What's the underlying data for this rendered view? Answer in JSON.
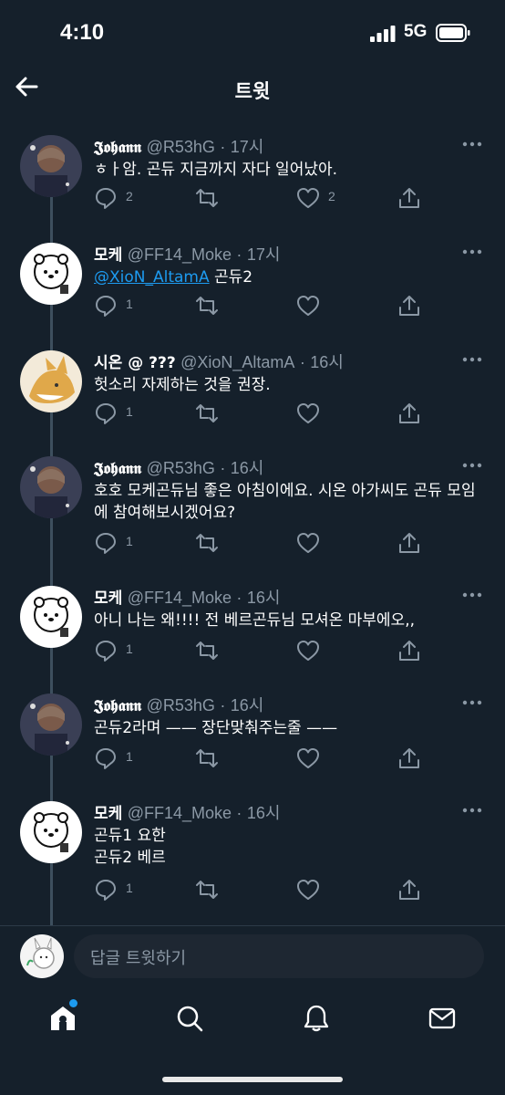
{
  "status": {
    "time": "4:10",
    "network": "5G"
  },
  "header": {
    "title": "트윗"
  },
  "tweets": [
    {
      "name": "𝕵𝖔𝖍𝖆𝖓𝖓",
      "handle": "@R53hG",
      "dot": "·",
      "time": "17시",
      "text": "ㅎㅏ암. 곤듀 지금까지 자다 일어났아.",
      "mention": "",
      "replies": "2",
      "retweets": "",
      "likes": "2"
    },
    {
      "name": "모케",
      "handle": "@FF14_Moke",
      "dot": "·",
      "time": "17시",
      "text": " 곤듀2",
      "mention": "@XioN_AltamA",
      "replies": "1",
      "retweets": "",
      "likes": ""
    },
    {
      "name": "시온 @ ???",
      "handle": "@XioN_AltamA",
      "dot": "·",
      "time": "16시",
      "text": "헛소리 자제하는 것을 권장.",
      "mention": "",
      "replies": "1",
      "retweets": "",
      "likes": ""
    },
    {
      "name": "𝕵𝖔𝖍𝖆𝖓𝖓",
      "handle": "@R53hG",
      "dot": "·",
      "time": "16시",
      "text": "호호 모케곤듀님 좋은 아침이에요. 시온 아가씨도 곤듀 모임에 참여해보시겠어요?",
      "mention": "",
      "replies": "1",
      "retweets": "",
      "likes": ""
    },
    {
      "name": "모케",
      "handle": "@FF14_Moke",
      "dot": "·",
      "time": "16시",
      "text": "아니 나는 왜!!!! 전 베르곤듀님 모셔온 마부에오,,",
      "mention": "",
      "replies": "1",
      "retweets": "",
      "likes": ""
    },
    {
      "name": "𝕵𝖔𝖍𝖆𝖓𝖓",
      "handle": "@R53hG",
      "dot": "·",
      "time": "16시",
      "text": "곤듀2라며 —— 장단맞춰주는줄 ——",
      "mention": "",
      "replies": "1",
      "retweets": "",
      "likes": ""
    },
    {
      "name": "모케",
      "handle": "@FF14_Moke",
      "dot": "·",
      "time": "16시",
      "text": "곤듀1 요한\n곤듀2 베르",
      "mention": "",
      "replies": "1",
      "retweets": "",
      "likes": ""
    }
  ],
  "reply": {
    "placeholder": "답글 트윗하기"
  },
  "colors": {
    "background": "#15202b",
    "accent": "#1d9bf0",
    "muted": "#8b98a5"
  },
  "icons": [
    "reply-icon",
    "retweet-icon",
    "like-icon",
    "share-icon",
    "more-icon",
    "home-icon",
    "search-icon",
    "notifications-icon",
    "messages-icon"
  ]
}
